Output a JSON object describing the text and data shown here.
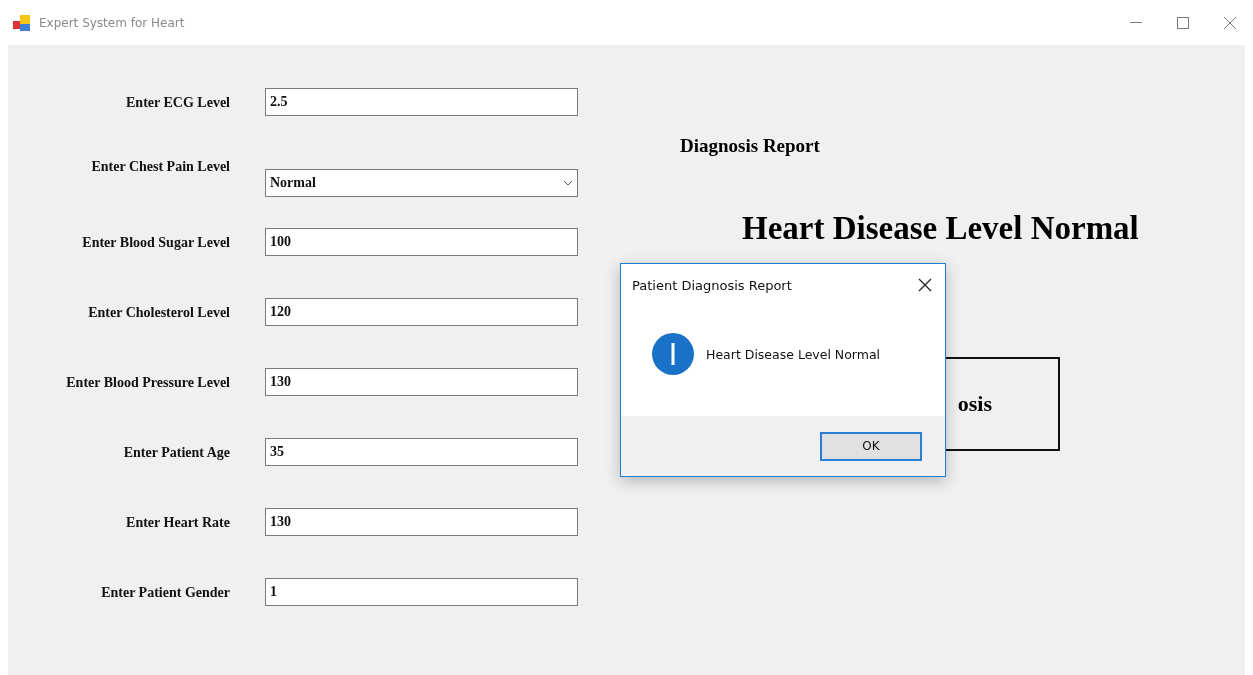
{
  "window": {
    "title": "Expert System for Heart"
  },
  "form": {
    "fields": [
      {
        "label": "Enter ECG Level",
        "kind": "text",
        "value": "2.5"
      },
      {
        "label": "Enter Chest Pain Level",
        "kind": "dropdown",
        "value": "Normal"
      },
      {
        "label": "Enter Blood Sugar Level",
        "kind": "text",
        "value": "100"
      },
      {
        "label": "Enter Cholesterol Level",
        "kind": "text",
        "value": "120"
      },
      {
        "label": "Enter Blood Pressure Level",
        "kind": "text",
        "value": "130"
      },
      {
        "label": "Enter Patient Age",
        "kind": "text",
        "value": "35"
      },
      {
        "label": "Enter Heart Rate",
        "kind": "text",
        "value": "130"
      },
      {
        "label": "Enter Patient Gender",
        "kind": "text",
        "value": "1"
      }
    ]
  },
  "report": {
    "heading": "Diagnosis Report",
    "result": "Heart Disease Level Normal",
    "button": "osis"
  },
  "dialog": {
    "title": "Patient Diagnosis Report",
    "message": "Heart Disease Level Normal",
    "button": "OK"
  }
}
